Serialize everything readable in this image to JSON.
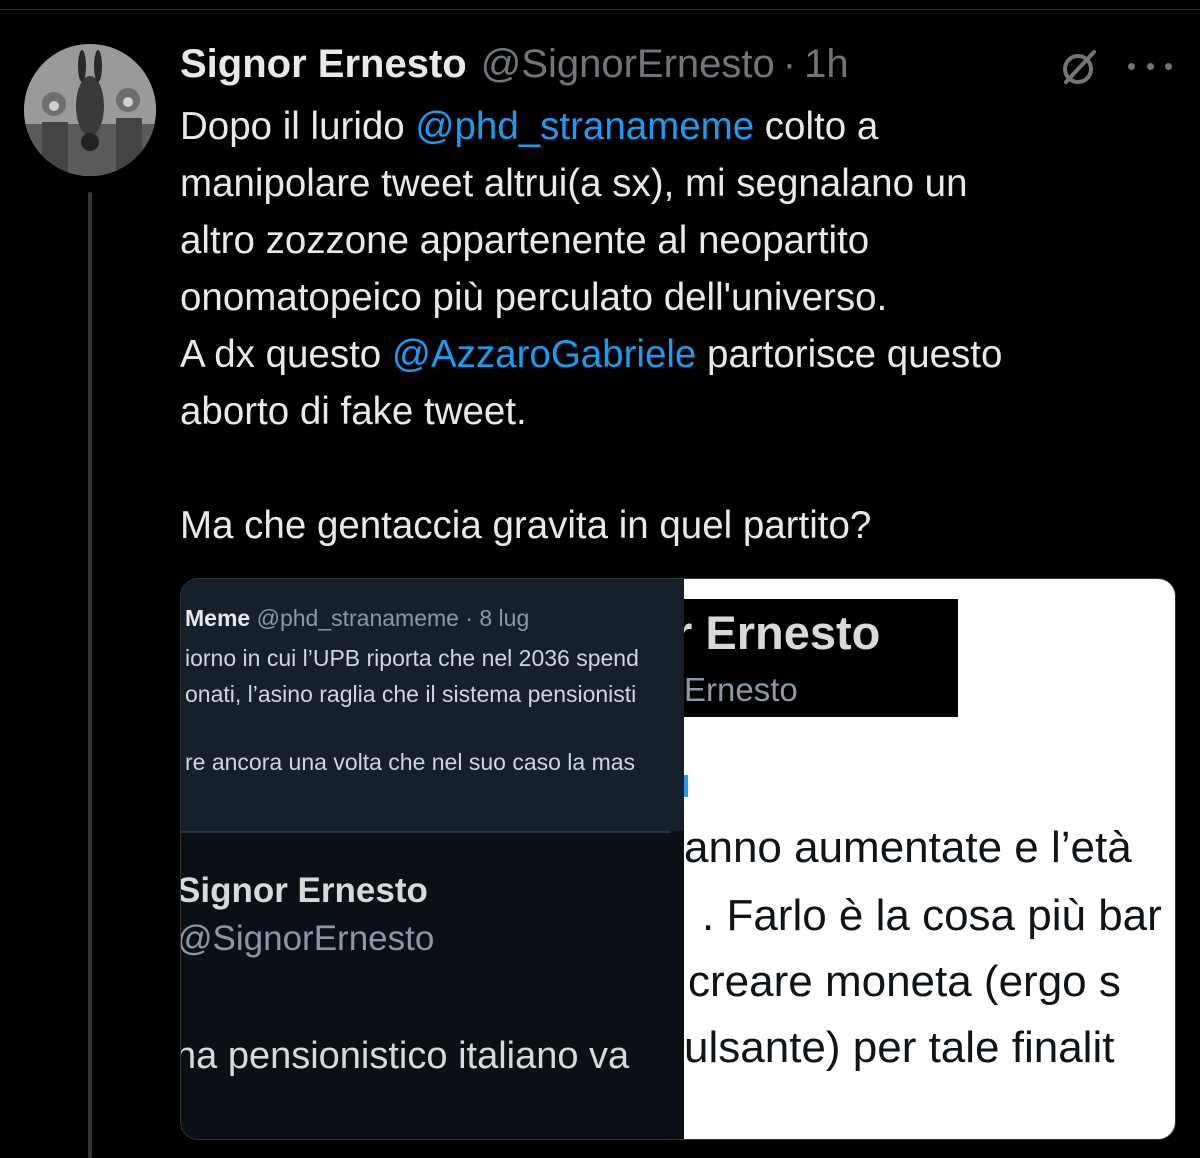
{
  "tweet": {
    "author_name": "Signor Ernesto",
    "author_handle": "@SignorErnesto",
    "separator": "·",
    "time": "1h",
    "text_parts": {
      "p1": "Dopo il lurido ",
      "m1": "@phd_stranameme",
      "p2": " colto a\nmanipolare tweet altrui(a sx), mi segnalano un\naltro zozzone appartenente al neopartito\nonomatopeico più perculato dell'universo.\nA dx questo ",
      "m2": "@AzzaroGabriele",
      "p3": " partorisce questo\naborto di fake tweet.\n\nMa che gentaccia gravita in quel partito?"
    }
  },
  "icons": {
    "grok": "slash-circle-icon",
    "more": "more-dots-icon"
  },
  "media": {
    "left": {
      "header_name": "Meme",
      "header_handle": "@phd_stranameme · 8 lug",
      "line1": "iorno in cui l’UPB riporta che nel 2036 spend",
      "line2": "onati, l’asino raglia che il sistema pensionisti",
      "line3": "re ancora una volta che nel suo caso la mas",
      "quoted_name": "Signor Ernesto",
      "quoted_handle": "@SignorErnesto",
      "quoted_text": "na pensionistico italiano va"
    },
    "right": {
      "name": "r Ernesto",
      "handle": "Ernesto",
      "line1": "anno aumentate e l’età",
      "line2": ". Farlo è la cosa più bar",
      "line3": "creare moneta (ergo s",
      "line4": "ulsante) per tale finalit"
    }
  },
  "colors": {
    "background": "#000000",
    "text": "#e7e9ea",
    "secondary": "#71767b",
    "mention": "#1d9bf0"
  }
}
